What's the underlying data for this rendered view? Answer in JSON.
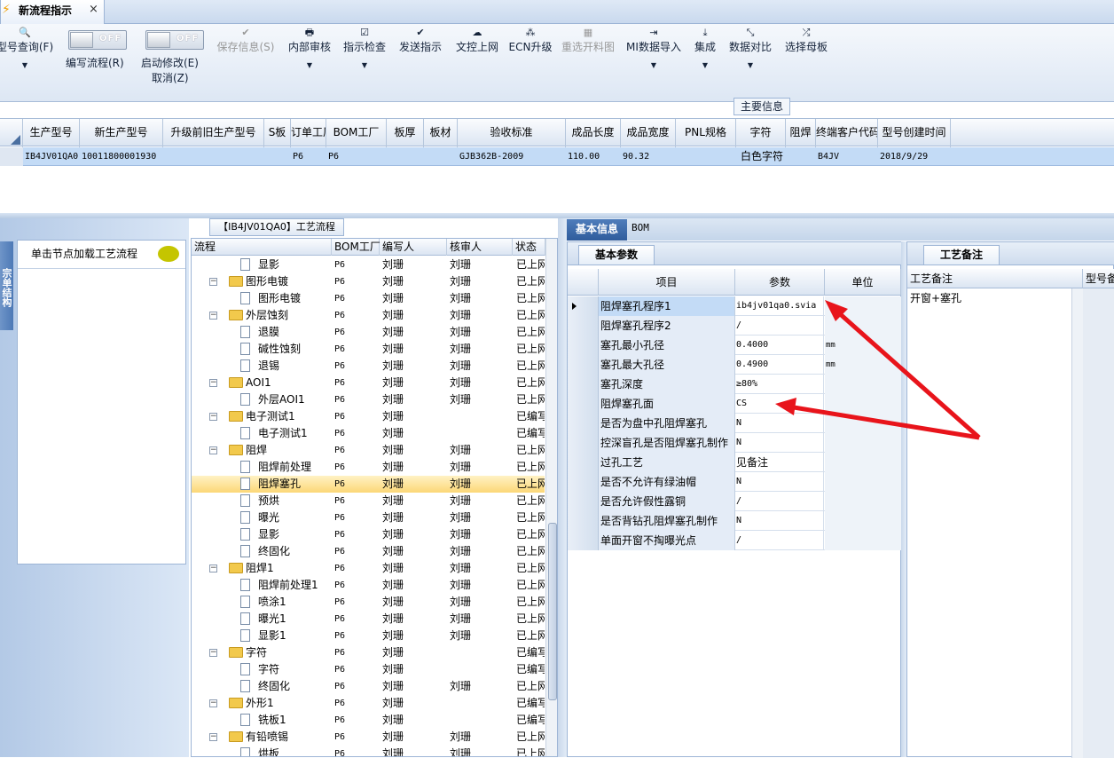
{
  "window": {
    "tab_title": "新流程指示",
    "close": "×",
    "bolt": "⚡"
  },
  "ribbon": {
    "buttons": [
      {
        "label": "型号查询(F)",
        "icon": "🔍",
        "dropdown": "▼"
      },
      {
        "label": "保存信息(S)",
        "icon": "✔"
      },
      {
        "label": "内部审核",
        "icon": "🖶",
        "dropdown": "▼"
      },
      {
        "label": "指示检查",
        "icon": "☑",
        "dropdown": "▼"
      },
      {
        "label": "发送指示",
        "icon": "✔"
      },
      {
        "label": "文控上网",
        "icon": "☁"
      },
      {
        "label": "ECN升级",
        "icon": "⁂"
      },
      {
        "label": "重选开料图",
        "icon": "▦"
      },
      {
        "label": "MI数据导入",
        "icon": "⇥",
        "dropdown": "▼"
      },
      {
        "label": "集成",
        "icon": "⤓",
        "dropdown": "▼"
      },
      {
        "label": "数据对比",
        "icon": "⤡",
        "dropdown": "▼"
      },
      {
        "label": "选择母板",
        "icon": "⤮"
      }
    ],
    "toggles": [
      {
        "state": "OFF",
        "label": "编写流程(R)"
      },
      {
        "state": "OFF",
        "label": "启动修改(E)",
        "sub": "取消(Z)"
      }
    ],
    "group_label": "主要信息"
  },
  "main_grid": {
    "headers": [
      "生产型号",
      "新生产型号",
      "升级前旧生产型号",
      "S板",
      "订单工厂",
      "BOM工厂",
      "板厚",
      "板材",
      "验收标准",
      "成品长度",
      "成品宽度",
      "PNL规格",
      "字符",
      "阻焊",
      "终端客户代码",
      "型号创建时间"
    ],
    "row": [
      "IB4JV01QA0",
      "10011800001930",
      "",
      "",
      "P6",
      "P6",
      "",
      "",
      "GJB362B-2009",
      "110.00",
      "90.32",
      "",
      "白色字符",
      "",
      "B4JV",
      "2018/9/29"
    ]
  },
  "left_nav": {
    "vertical_tab": "宗单结构",
    "panel_label": "单击节点加载工艺流程"
  },
  "flow": {
    "title": "【IB4JV01QA0】工艺流程",
    "headers": [
      "流程",
      "BOM工厂",
      "编写人",
      "核审人",
      "状态"
    ],
    "rows": [
      {
        "name": "显影",
        "level": 2,
        "type": "doc",
        "bom": "P6",
        "writer": "刘珊",
        "reviewer": "刘珊",
        "status": "已上网"
      },
      {
        "name": "图形电镀",
        "level": 1,
        "type": "folder",
        "bom": "P6",
        "writer": "刘珊",
        "reviewer": "刘珊",
        "status": "已上网"
      },
      {
        "name": "图形电镀",
        "level": 2,
        "type": "doc",
        "bom": "P6",
        "writer": "刘珊",
        "reviewer": "刘珊",
        "status": "已上网"
      },
      {
        "name": "外层蚀刻",
        "level": 1,
        "type": "folder",
        "bom": "P6",
        "writer": "刘珊",
        "reviewer": "刘珊",
        "status": "已上网"
      },
      {
        "name": "退膜",
        "level": 2,
        "type": "doc",
        "bom": "P6",
        "writer": "刘珊",
        "reviewer": "刘珊",
        "status": "已上网"
      },
      {
        "name": "碱性蚀刻",
        "level": 2,
        "type": "doc",
        "bom": "P6",
        "writer": "刘珊",
        "reviewer": "刘珊",
        "status": "已上网"
      },
      {
        "name": "退锡",
        "level": 2,
        "type": "doc",
        "bom": "P6",
        "writer": "刘珊",
        "reviewer": "刘珊",
        "status": "已上网"
      },
      {
        "name": "AOI1",
        "level": 1,
        "type": "folder",
        "bom": "P6",
        "writer": "刘珊",
        "reviewer": "刘珊",
        "status": "已上网"
      },
      {
        "name": "外层AOI1",
        "level": 2,
        "type": "doc",
        "bom": "P6",
        "writer": "刘珊",
        "reviewer": "刘珊",
        "status": "已上网"
      },
      {
        "name": "电子测试1",
        "level": 1,
        "type": "folder",
        "bom": "P6",
        "writer": "刘珊",
        "reviewer": "",
        "status": "已编写"
      },
      {
        "name": "电子测试1",
        "level": 2,
        "type": "doc",
        "bom": "P6",
        "writer": "刘珊",
        "reviewer": "",
        "status": "已编写"
      },
      {
        "name": "阻焊",
        "level": 1,
        "type": "folder",
        "bom": "P6",
        "writer": "刘珊",
        "reviewer": "刘珊",
        "status": "已上网"
      },
      {
        "name": "阻焊前处理",
        "level": 2,
        "type": "doc",
        "bom": "P6",
        "writer": "刘珊",
        "reviewer": "刘珊",
        "status": "已上网"
      },
      {
        "name": "阻焊塞孔",
        "level": 2,
        "type": "doc",
        "bom": "P6",
        "writer": "刘珊",
        "reviewer": "刘珊",
        "status": "已上网",
        "selected": true
      },
      {
        "name": "预烘",
        "level": 2,
        "type": "doc",
        "bom": "P6",
        "writer": "刘珊",
        "reviewer": "刘珊",
        "status": "已上网"
      },
      {
        "name": "曝光",
        "level": 2,
        "type": "doc",
        "bom": "P6",
        "writer": "刘珊",
        "reviewer": "刘珊",
        "status": "已上网"
      },
      {
        "name": "显影",
        "level": 2,
        "type": "doc",
        "bom": "P6",
        "writer": "刘珊",
        "reviewer": "刘珊",
        "status": "已上网"
      },
      {
        "name": "终固化",
        "level": 2,
        "type": "doc",
        "bom": "P6",
        "writer": "刘珊",
        "reviewer": "刘珊",
        "status": "已上网"
      },
      {
        "name": "阻焊1",
        "level": 1,
        "type": "folder",
        "bom": "P6",
        "writer": "刘珊",
        "reviewer": "刘珊",
        "status": "已上网"
      },
      {
        "name": "阻焊前处理1",
        "level": 2,
        "type": "doc",
        "bom": "P6",
        "writer": "刘珊",
        "reviewer": "刘珊",
        "status": "已上网"
      },
      {
        "name": "喷涂1",
        "level": 2,
        "type": "doc",
        "bom": "P6",
        "writer": "刘珊",
        "reviewer": "刘珊",
        "status": "已上网"
      },
      {
        "name": "曝光1",
        "level": 2,
        "type": "doc",
        "bom": "P6",
        "writer": "刘珊",
        "reviewer": "刘珊",
        "status": "已上网"
      },
      {
        "name": "显影1",
        "level": 2,
        "type": "doc",
        "bom": "P6",
        "writer": "刘珊",
        "reviewer": "刘珊",
        "status": "已上网"
      },
      {
        "name": "字符",
        "level": 1,
        "type": "folder",
        "bom": "P6",
        "writer": "刘珊",
        "reviewer": "",
        "status": "已编写"
      },
      {
        "name": "字符",
        "level": 2,
        "type": "doc",
        "bom": "P6",
        "writer": "刘珊",
        "reviewer": "",
        "status": "已编写"
      },
      {
        "name": "终固化",
        "level": 2,
        "type": "doc",
        "bom": "P6",
        "writer": "刘珊",
        "reviewer": "刘珊",
        "status": "已上网"
      },
      {
        "name": "外形1",
        "level": 1,
        "type": "folder",
        "bom": "P6",
        "writer": "刘珊",
        "reviewer": "",
        "status": "已编写"
      },
      {
        "name": "铣板1",
        "level": 2,
        "type": "doc",
        "bom": "P6",
        "writer": "刘珊",
        "reviewer": "",
        "status": "已编写"
      },
      {
        "name": "有铅喷锡",
        "level": 1,
        "type": "folder",
        "bom": "P6",
        "writer": "刘珊",
        "reviewer": "刘珊",
        "status": "已上网"
      },
      {
        "name": "烘板",
        "level": 2,
        "type": "doc",
        "bom": "P6",
        "writer": "刘珊",
        "reviewer": "刘珊",
        "status": "已上网"
      }
    ]
  },
  "right_tabs": {
    "active": "基本信息",
    "other": "BOM"
  },
  "params": {
    "tab": "基本参数",
    "headers": [
      "项目",
      "参数",
      "单位"
    ],
    "rows": [
      {
        "item": "阻焊塞孔程序1",
        "value": "ib4jv01qa0.svia",
        "unit": ""
      },
      {
        "item": "阻焊塞孔程序2",
        "value": "/",
        "unit": ""
      },
      {
        "item": "塞孔最小孔径",
        "value": "0.4000",
        "unit": "mm"
      },
      {
        "item": "塞孔最大孔径",
        "value": "0.4900",
        "unit": "mm"
      },
      {
        "item": "塞孔深度",
        "value": "≥80%",
        "unit": ""
      },
      {
        "item": "阻焊塞孔面",
        "value": "CS",
        "unit": ""
      },
      {
        "item": "是否为盘中孔阻焊塞孔",
        "value": "N",
        "unit": ""
      },
      {
        "item": "控深盲孔是否阻焊塞孔制作",
        "value": "N",
        "unit": ""
      },
      {
        "item": "过孔工艺",
        "value": "见备注",
        "unit": ""
      },
      {
        "item": "是否不允许有绿油帽",
        "value": "N",
        "unit": ""
      },
      {
        "item": "是否允许假性露铜",
        "value": "/",
        "unit": ""
      },
      {
        "item": "是否背钻孔阻焊塞孔制作",
        "value": "N",
        "unit": ""
      },
      {
        "item": "单面开窗不掏曝光点",
        "value": "/",
        "unit": ""
      }
    ]
  },
  "notes": {
    "tab": "工艺备注",
    "headers": [
      "工艺备注",
      "型号备注"
    ],
    "text": "开窗+塞孔"
  },
  "annotation": {
    "arrow_color": "#e8141b"
  }
}
